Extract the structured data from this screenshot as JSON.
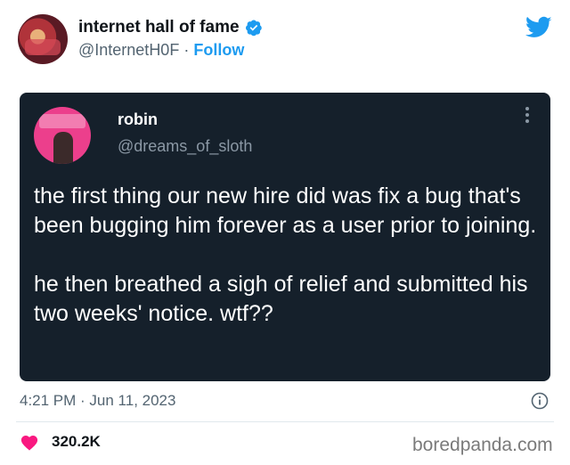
{
  "author": {
    "display_name": "internet hall of fame",
    "handle": "@InternetH0F",
    "separator": " · ",
    "follow_label": "Follow"
  },
  "quoted_tweet": {
    "name": "robin",
    "handle": "@dreams_of_sloth",
    "text": "the first thing our new hire did was fix a bug that's been bugging him forever as a user prior to joining.\n\nhe then breathed a sigh of relief and submitted his two weeks' notice. wtf??"
  },
  "meta": {
    "timestamp": "4:21 PM · Jun 11, 2023",
    "like_count": "320.2K"
  },
  "watermark": "boredpanda.com",
  "icons": {
    "verified": "verified-badge-icon",
    "twitter": "twitter-bird-icon",
    "more": "more-dots-icon",
    "info": "info-icon",
    "heart": "heart-icon"
  },
  "colors": {
    "accent": "#1d9bf0",
    "quoted_bg": "#15202b",
    "heart": "#f91880",
    "muted": "#536471"
  }
}
